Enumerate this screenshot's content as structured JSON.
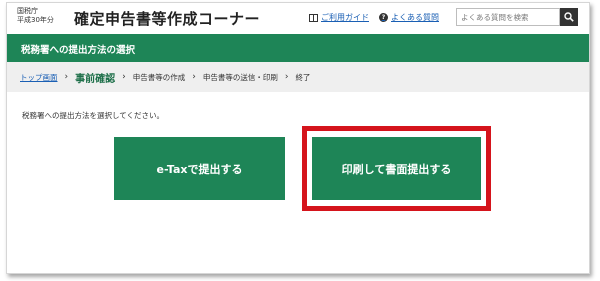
{
  "header": {
    "agency_line1": "国税庁",
    "agency_line2": "平成30年分",
    "app_title": "確定申告書等作成コーナー",
    "guide_label": "ご利用ガイド",
    "faq_label": "よくある質問",
    "search_placeholder": "よくある質問を検索"
  },
  "title_bar": {
    "text": "税務署への提出方法の選択"
  },
  "breadcrumb": {
    "items": [
      {
        "label": "トップ画面",
        "type": "link"
      },
      {
        "label": "事前確認",
        "type": "current"
      },
      {
        "label": "申告書等の作成",
        "type": "step"
      },
      {
        "label": "申告書等の送信・印刷",
        "type": "step"
      },
      {
        "label": "終了",
        "type": "step"
      }
    ],
    "separator": "›"
  },
  "main": {
    "instruction": "税務署への提出方法を選択してください。",
    "etax_button": "e-Taxで提出する",
    "print_button": "印刷して書面提出する"
  },
  "colors": {
    "brand_green": "#1e8557",
    "highlight_red": "#d5141c",
    "link_blue": "#1a5fb4"
  },
  "icons": {
    "guide": "book-icon",
    "faq": "question-icon",
    "search": "search-icon"
  }
}
